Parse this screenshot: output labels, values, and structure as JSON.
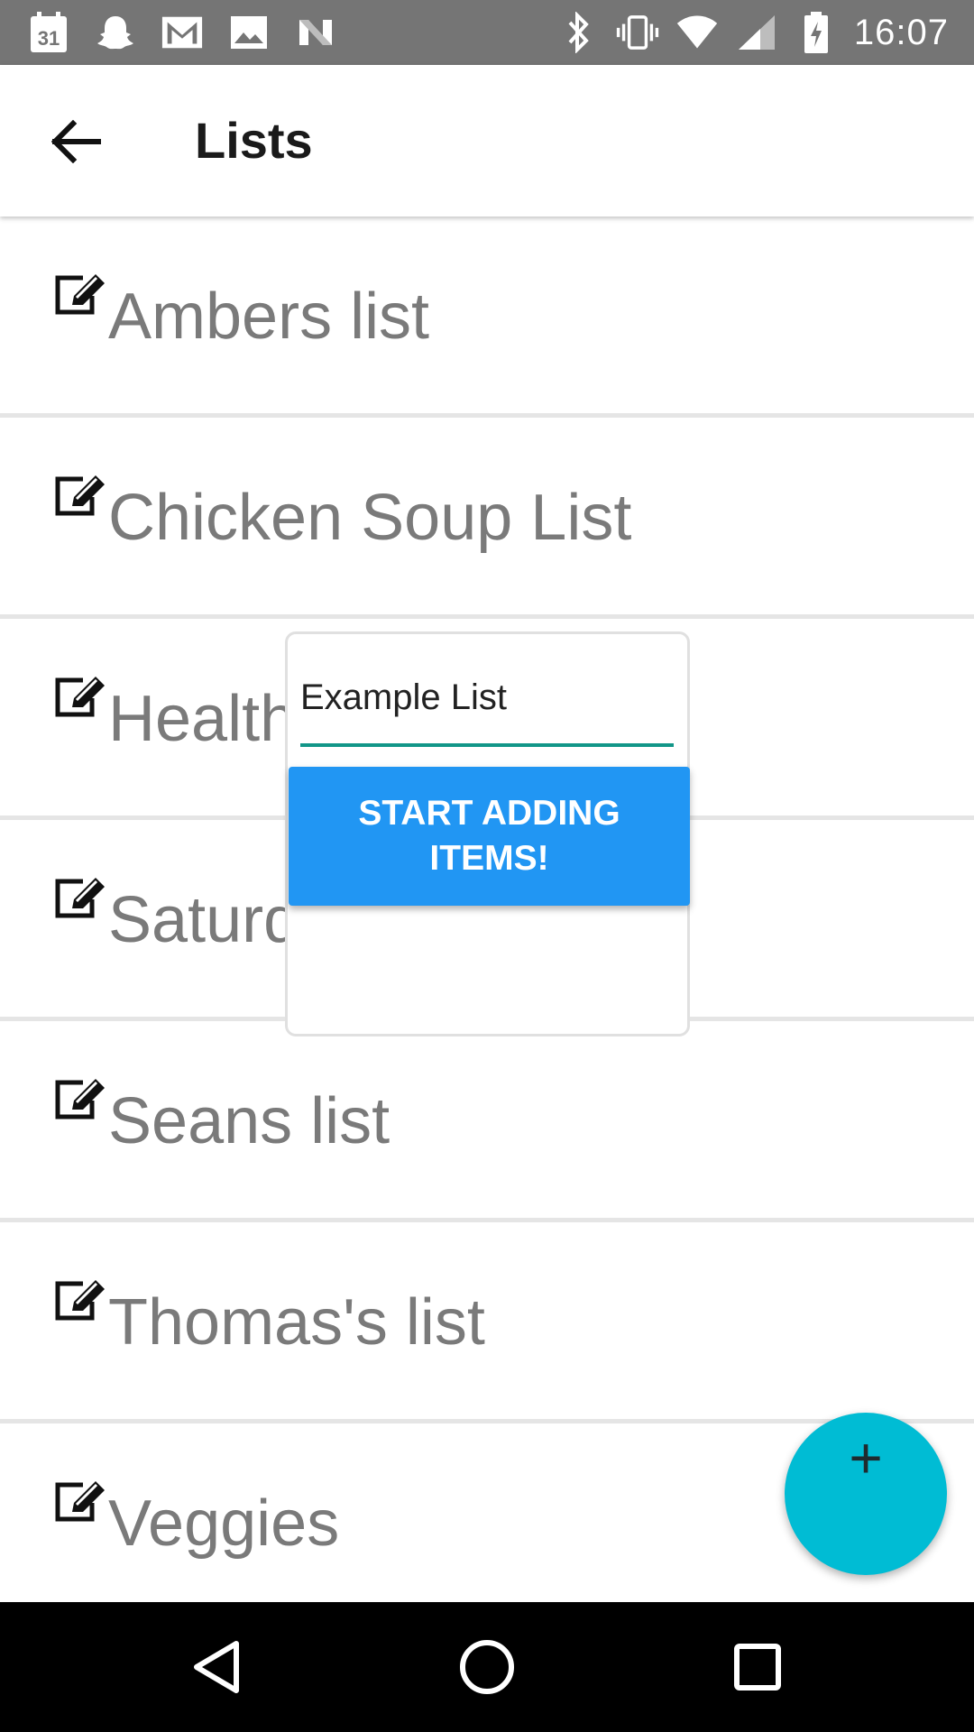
{
  "status_bar": {
    "time": "16:07",
    "calendar_day": "31",
    "left_icons": [
      "calendar-icon",
      "snapchat-icon",
      "gmail-icon",
      "photos-icon",
      "n-app-icon"
    ],
    "right_icons": [
      "bluetooth-icon",
      "vibrate-icon",
      "wifi-icon",
      "signal-icon",
      "battery-charging-icon"
    ]
  },
  "app_bar": {
    "title": "Lists",
    "back_icon": "arrow-back-icon"
  },
  "lists": [
    {
      "label": "Ambers list"
    },
    {
      "label": "Chicken Soup List"
    },
    {
      "label": "Health"
    },
    {
      "label": "Saturd"
    },
    {
      "label": "Seans list"
    },
    {
      "label": "Thomas's list"
    },
    {
      "label": "Veggies"
    }
  ],
  "dialog": {
    "input_value": "Example List",
    "button_label": "START ADDING ITEMS!",
    "accent_color": "#129688",
    "button_color": "#2196f3"
  },
  "fab": {
    "label": "+",
    "color": "#00bcd4"
  },
  "nav_bar": {
    "buttons": [
      "back-triangle-icon",
      "home-circle-icon",
      "recents-square-icon"
    ]
  }
}
